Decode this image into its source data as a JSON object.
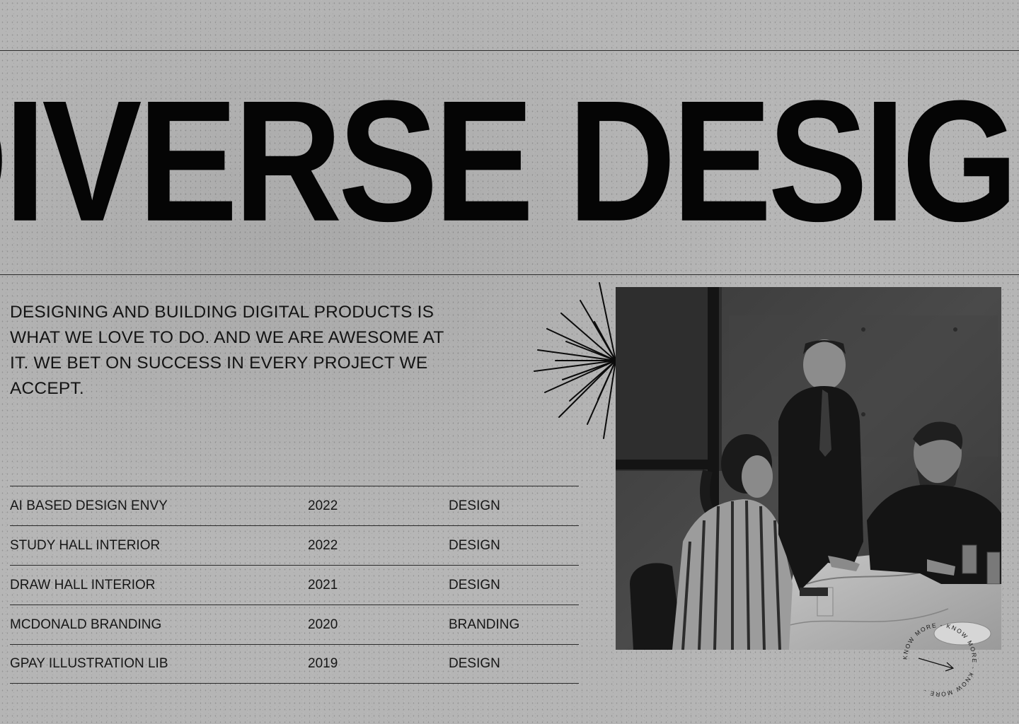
{
  "hero": {
    "title": "DIVERSE DESIGN"
  },
  "intro": {
    "text": "DESIGNING AND BUILDING DIGITAL PRODUCTS IS WHAT WE LOVE TO DO. AND WE ARE AWESOME AT IT. WE BET ON SUCCESS IN EVERY PROJECT WE ACCEPT."
  },
  "projects": [
    {
      "name": "AI BASED DESIGN ENVY",
      "year": "2022",
      "category": "DESIGN"
    },
    {
      "name": "STUDY HALL INTERIOR",
      "year": "2022",
      "category": "DESIGN"
    },
    {
      "name": "DRAW HALL INTERIOR",
      "year": "2021",
      "category": "DESIGN"
    },
    {
      "name": "MCDONALD BRANDING",
      "year": "2020",
      "category": "BRANDING"
    },
    {
      "name": "GPAY ILLUSTRATION LIB",
      "year": "2019",
      "category": "DESIGN"
    }
  ],
  "know_more": {
    "label": "KNOW MORE - KNOW MORE - KNOW MORE -"
  },
  "icons": {
    "burst": "starburst-icon",
    "arrow": "arrow-up-right-icon"
  },
  "colors": {
    "background": "#b3b3b3",
    "ink": "#0d0d0d",
    "rule": "#2a2a2a"
  }
}
